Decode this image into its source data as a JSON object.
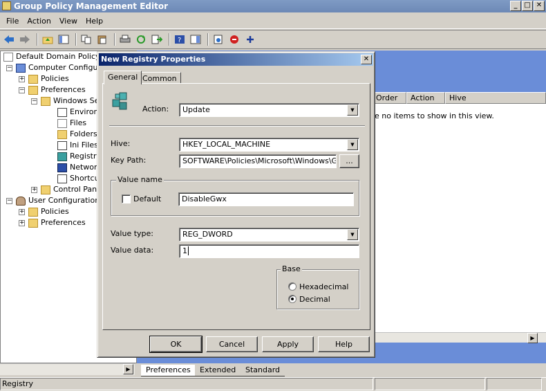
{
  "window": {
    "title": "Group Policy Management Editor",
    "min": "_",
    "max": "□",
    "close": "✕"
  },
  "menu": [
    "File",
    "Action",
    "View",
    "Help"
  ],
  "tree": {
    "root": "Default Domain Policy [S",
    "computer_config": "Computer Configura",
    "policies": "Policies",
    "preferences": "Preferences",
    "windows_settings": "Windows Se",
    "environment": "Environn",
    "files": "Files",
    "folders": "Folders",
    "ini_files": "Ini Files",
    "registry": "Registry",
    "network": "Network",
    "shortcuts": "Shortcut",
    "control_panel": "Control Pane",
    "user_config": "User Configuration",
    "user_policies": "Policies",
    "user_preferences": "Preferences"
  },
  "list": {
    "columns": [
      "Order",
      "Action",
      "Hive"
    ],
    "empty_text": "e no items to show in this view."
  },
  "bottom_tabs": [
    "Preferences",
    "Extended",
    "Standard"
  ],
  "status": {
    "text": "Registry"
  },
  "dialog": {
    "title": "New Registry Properties",
    "close": "✕",
    "tabs": [
      "General",
      "Common"
    ],
    "action_label": "Action:",
    "action_value": "Update",
    "hive_label": "Hive:",
    "hive_value": "HKEY_LOCAL_MACHINE",
    "keypath_label": "Key Path:",
    "keypath_value": "SOFTWARE\\Policies\\Microsoft\\Windows\\GWX",
    "browse": "...",
    "value_name_group": "Value name",
    "default_label": "Default",
    "value_name": "DisableGwx",
    "value_type_label": "Value type:",
    "value_type": "REG_DWORD",
    "value_data_label": "Value data:",
    "value_data": "1",
    "base_group": "Base",
    "hex_label": "Hexadecimal",
    "decimal_label": "Decimal",
    "buttons": {
      "ok": "OK",
      "cancel": "Cancel",
      "apply": "Apply",
      "help": "Help"
    }
  }
}
